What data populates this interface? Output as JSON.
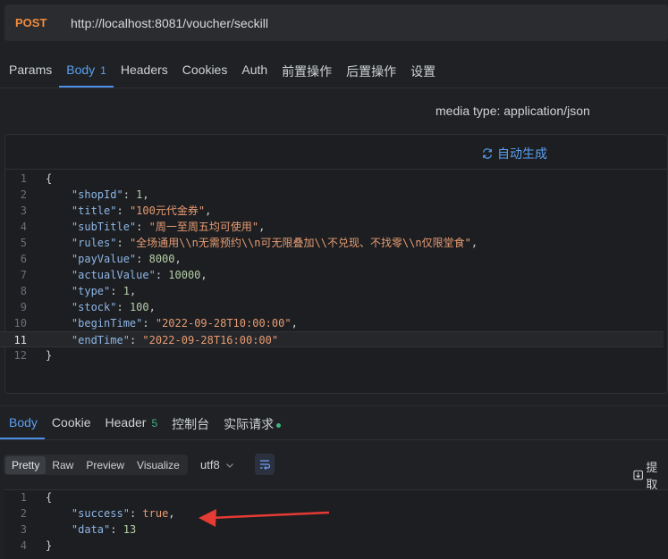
{
  "request": {
    "method": "POST",
    "url": "http://localhost:8081/voucher/seckill"
  },
  "request_tabs": [
    {
      "label": "Params"
    },
    {
      "label": "Body",
      "badge": "1"
    },
    {
      "label": "Headers"
    },
    {
      "label": "Cookies"
    },
    {
      "label": "Auth"
    },
    {
      "label": "前置操作"
    },
    {
      "label": "后置操作"
    },
    {
      "label": "设置"
    }
  ],
  "media_type": "media type: application/json",
  "auto_generate": "自动生成",
  "request_body_lines": [
    {
      "num": "1",
      "text": "{"
    },
    {
      "num": "2",
      "key": "\"shopId\"",
      "val": "1",
      "type": "n",
      "comma": ","
    },
    {
      "num": "3",
      "key": "\"title\"",
      "val": "\"100元代金券\"",
      "type": "s",
      "comma": ","
    },
    {
      "num": "4",
      "key": "\"subTitle\"",
      "val": "\"周一至周五均可使用\"",
      "type": "s",
      "comma": ","
    },
    {
      "num": "5",
      "key": "\"rules\"",
      "val": "\"全场通用\\\\n无需预约\\\\n可无限叠加\\\\不兑现、不找零\\\\n仅限堂食\"",
      "type": "s",
      "comma": ","
    },
    {
      "num": "6",
      "key": "\"payValue\"",
      "val": "8000",
      "type": "n",
      "comma": ","
    },
    {
      "num": "7",
      "key": "\"actualValue\"",
      "val": "10000",
      "type": "n",
      "comma": ","
    },
    {
      "num": "8",
      "key": "\"type\"",
      "val": "1",
      "type": "n",
      "comma": ","
    },
    {
      "num": "9",
      "key": "\"stock\"",
      "val": "100",
      "type": "n",
      "comma": ","
    },
    {
      "num": "10",
      "key": "\"beginTime\"",
      "val": "\"2022-09-28T10:00:00\"",
      "type": "s",
      "comma": ","
    },
    {
      "num": "11",
      "key": "\"endTime\"",
      "val": "\"2022-09-28T16:00:00\"",
      "type": "s",
      "comma": "",
      "current": true
    },
    {
      "num": "12",
      "text": "}"
    }
  ],
  "response_tabs": [
    {
      "label": "Body"
    },
    {
      "label": "Cookie"
    },
    {
      "label": "Header",
      "badge": "5"
    },
    {
      "label": "控制台"
    },
    {
      "label": "实际请求"
    }
  ],
  "format_options": [
    "Pretty",
    "Raw",
    "Preview",
    "Visualize"
  ],
  "encoding": "utf8",
  "extract_label": "提取",
  "response_body_lines": [
    {
      "num": "1",
      "text": "{"
    },
    {
      "num": "2",
      "key": "\"success\"",
      "val": "true",
      "type": "b",
      "comma": ","
    },
    {
      "num": "3",
      "key": "\"data\"",
      "val": "13",
      "type": "n",
      "comma": ""
    },
    {
      "num": "4",
      "text": "}"
    }
  ],
  "colors": {
    "method": "#f28b3c",
    "accent": "#5aa0f2",
    "annotation_arrow": "#e53b34"
  }
}
